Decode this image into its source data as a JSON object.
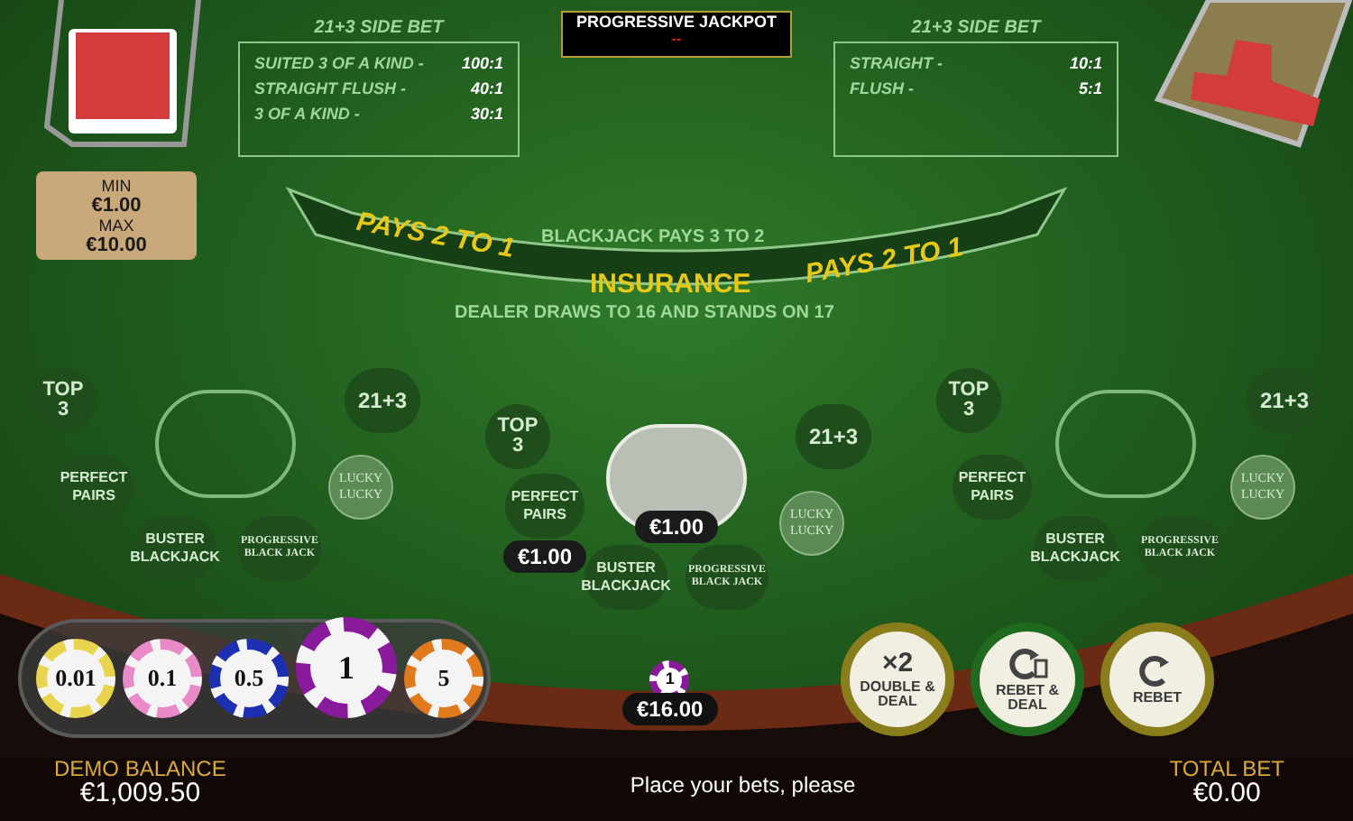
{
  "jackpot": {
    "title": "PROGRESSIVE JACKPOT",
    "value": "--"
  },
  "side_bet_panels": [
    {
      "title": "21+3 SIDE BET",
      "rows": [
        {
          "name": "SUITED 3 OF A KIND -",
          "odds": "100:1"
        },
        {
          "name": "STRAIGHT FLUSH -",
          "odds": "40:1"
        },
        {
          "name": "3 OF A KIND -",
          "odds": "30:1"
        }
      ]
    },
    {
      "title": "21+3 SIDE BET",
      "rows": [
        {
          "name": "STRAIGHT -",
          "odds": "10:1"
        },
        {
          "name": "FLUSH -",
          "odds": "5:1"
        }
      ]
    }
  ],
  "limits": {
    "min_label": "MIN",
    "min": "€1.00",
    "max_label": "MAX",
    "max": "€10.00"
  },
  "banner": {
    "top": "BLACKJACK PAYS 3 TO 2",
    "left": "PAYS 2 TO 1",
    "center": "INSURANCE",
    "right": "PAYS 2 TO 1",
    "bottom": "DEALER DRAWS TO 16 AND STANDS ON 17"
  },
  "seats": [
    {
      "active": false,
      "spots": [
        {
          "kind": "top3",
          "label": "TOP 3"
        },
        {
          "kind": "twentyone",
          "label": "21+3"
        },
        {
          "kind": "pairs",
          "label": "PERFECT PAIRS"
        },
        {
          "kind": "lucky",
          "label": "LUCKY LUCKY"
        },
        {
          "kind": "buster",
          "label": "BUSTER BLACKJACK"
        },
        {
          "kind": "progressive",
          "label": "PROGRESSIVE BLACK JACK"
        }
      ]
    },
    {
      "active": true,
      "bet": "€1.00",
      "spots": [
        {
          "kind": "top3",
          "label": "TOP 3"
        },
        {
          "kind": "twentyone",
          "label": "21+3"
        },
        {
          "kind": "pairs",
          "label": "PERFECT PAIRS",
          "bet": "€1.00"
        },
        {
          "kind": "lucky",
          "label": "LUCKY LUCKY"
        },
        {
          "kind": "buster",
          "label": "BUSTER BLACKJACK"
        },
        {
          "kind": "progressive",
          "label": "PROGRESSIVE BLACK JACK"
        }
      ]
    },
    {
      "active": false,
      "spots": [
        {
          "kind": "top3",
          "label": "TOP 3"
        },
        {
          "kind": "twentyone",
          "label": "21+3"
        },
        {
          "kind": "pairs",
          "label": "PERFECT PAIRS"
        },
        {
          "kind": "lucky",
          "label": "LUCKY LUCKY"
        },
        {
          "kind": "buster",
          "label": "BUSTER BLACKJACK"
        },
        {
          "kind": "progressive",
          "label": "PROGRESSIVE BLACK JACK"
        }
      ]
    }
  ],
  "chips": [
    {
      "value": "0.01",
      "color": "#e8d44d",
      "selected": false
    },
    {
      "value": "0.1",
      "color": "#e98bc9",
      "selected": false
    },
    {
      "value": "0.5",
      "color": "#1c2fb0",
      "selected": false
    },
    {
      "value": "1",
      "color": "#8a1a9c",
      "selected": true
    },
    {
      "value": "5",
      "color": "#e07a1c",
      "selected": false
    }
  ],
  "pot": {
    "chip": "1",
    "amount": "€16.00"
  },
  "actions": [
    {
      "kind": "double",
      "symbol": "×2",
      "label": "DOUBLE & DEAL"
    },
    {
      "kind": "rebet_deal",
      "label": "REBET & DEAL"
    },
    {
      "kind": "rebet",
      "label": "REBET"
    }
  ],
  "footer": {
    "balance_label": "DEMO BALANCE",
    "balance": "€1,009.50",
    "message": "Place your bets, please",
    "total_label": "TOTAL BET",
    "total": "€0.00"
  }
}
